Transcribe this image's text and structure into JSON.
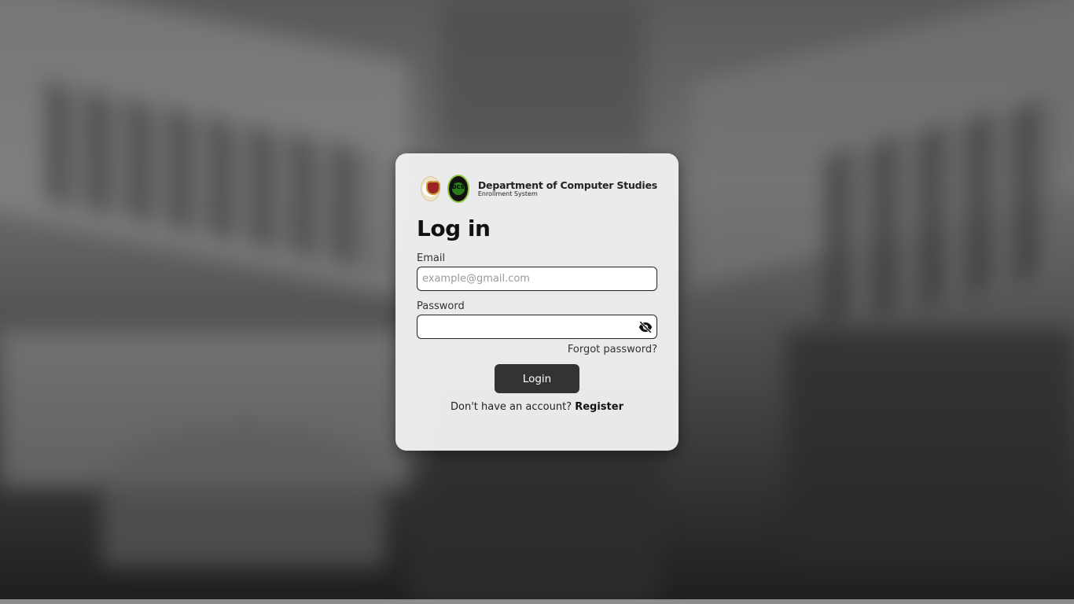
{
  "brand": {
    "title": "Department of Computer Studies",
    "subtitle": "Enrollment System",
    "logos": [
      "university-seal-icon",
      "dcs-logo-icon"
    ]
  },
  "form": {
    "heading": "Log in",
    "email_label": "Email",
    "email_value": "",
    "email_placeholder": "example@gmail.com",
    "password_label": "Password",
    "password_value": "",
    "password_toggle_icon": "eye-slash-icon",
    "forgot_label": "Forgot password?",
    "login_label": "Login",
    "register_prompt": "Don't have an account?",
    "register_label": "Register"
  },
  "colors": {
    "button_bg": "#333333",
    "card_bg": "#f0f0f0"
  }
}
